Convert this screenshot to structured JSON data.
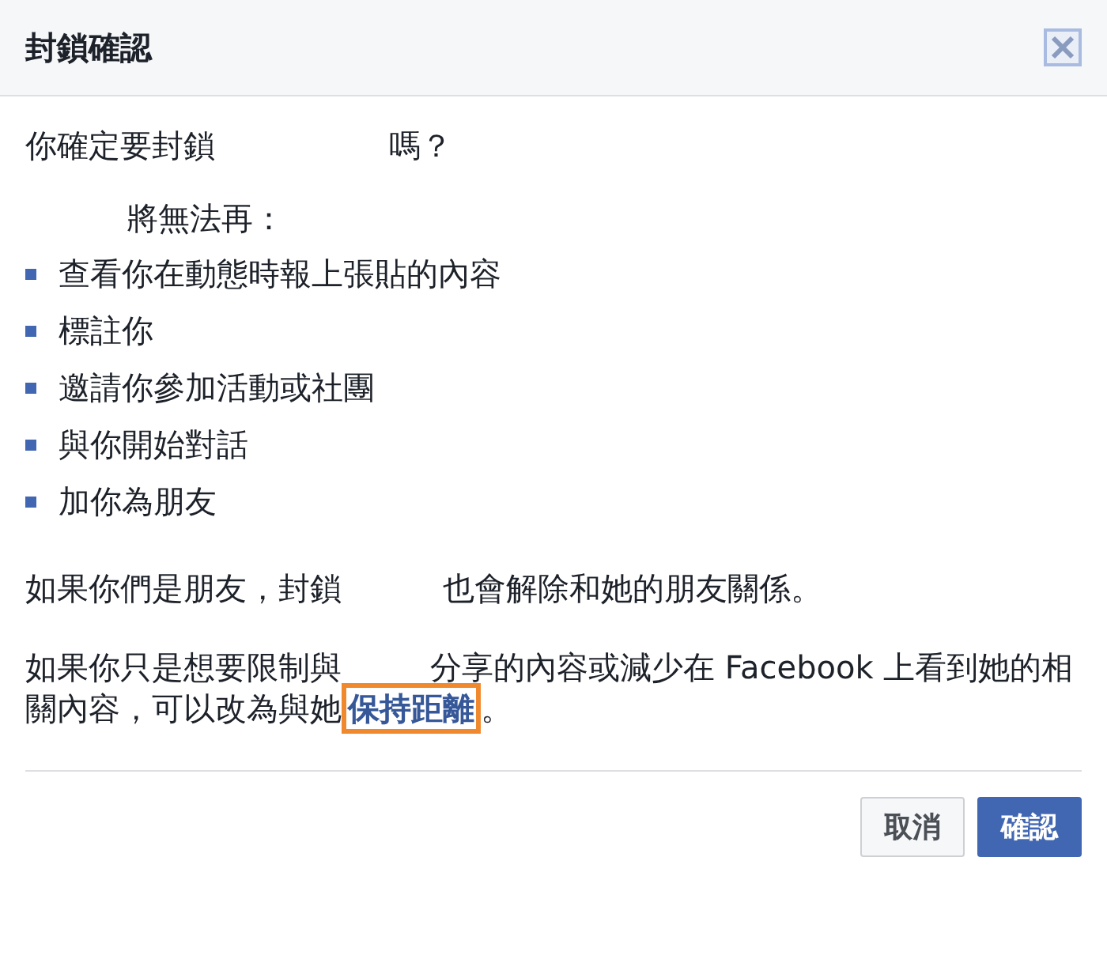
{
  "dialog": {
    "title": "封鎖確認"
  },
  "question": {
    "before": "你確定要封鎖",
    "after": "嗎？"
  },
  "list_intro": "將無法再：",
  "items": [
    "查看你在動態時報上張貼的內容",
    "標註你",
    "邀請你參加活動或社團",
    "與你開始對話",
    "加你為朋友"
  ],
  "friends_note": {
    "before": "如果你們是朋友，封鎖",
    "after": "也會解除和她的朋友關係。"
  },
  "limit_note": {
    "before": "如果你只是想要限制與",
    "after": "分享的內容或減少在 Facebook 上看到她的相關內容，可以改為與她",
    "link": "保持距離",
    "link_highlighted": true,
    "end": "。"
  },
  "buttons": [
    {
      "label": "取消",
      "kind": "secondary"
    },
    {
      "label": "確認",
      "kind": "primary"
    }
  ]
}
